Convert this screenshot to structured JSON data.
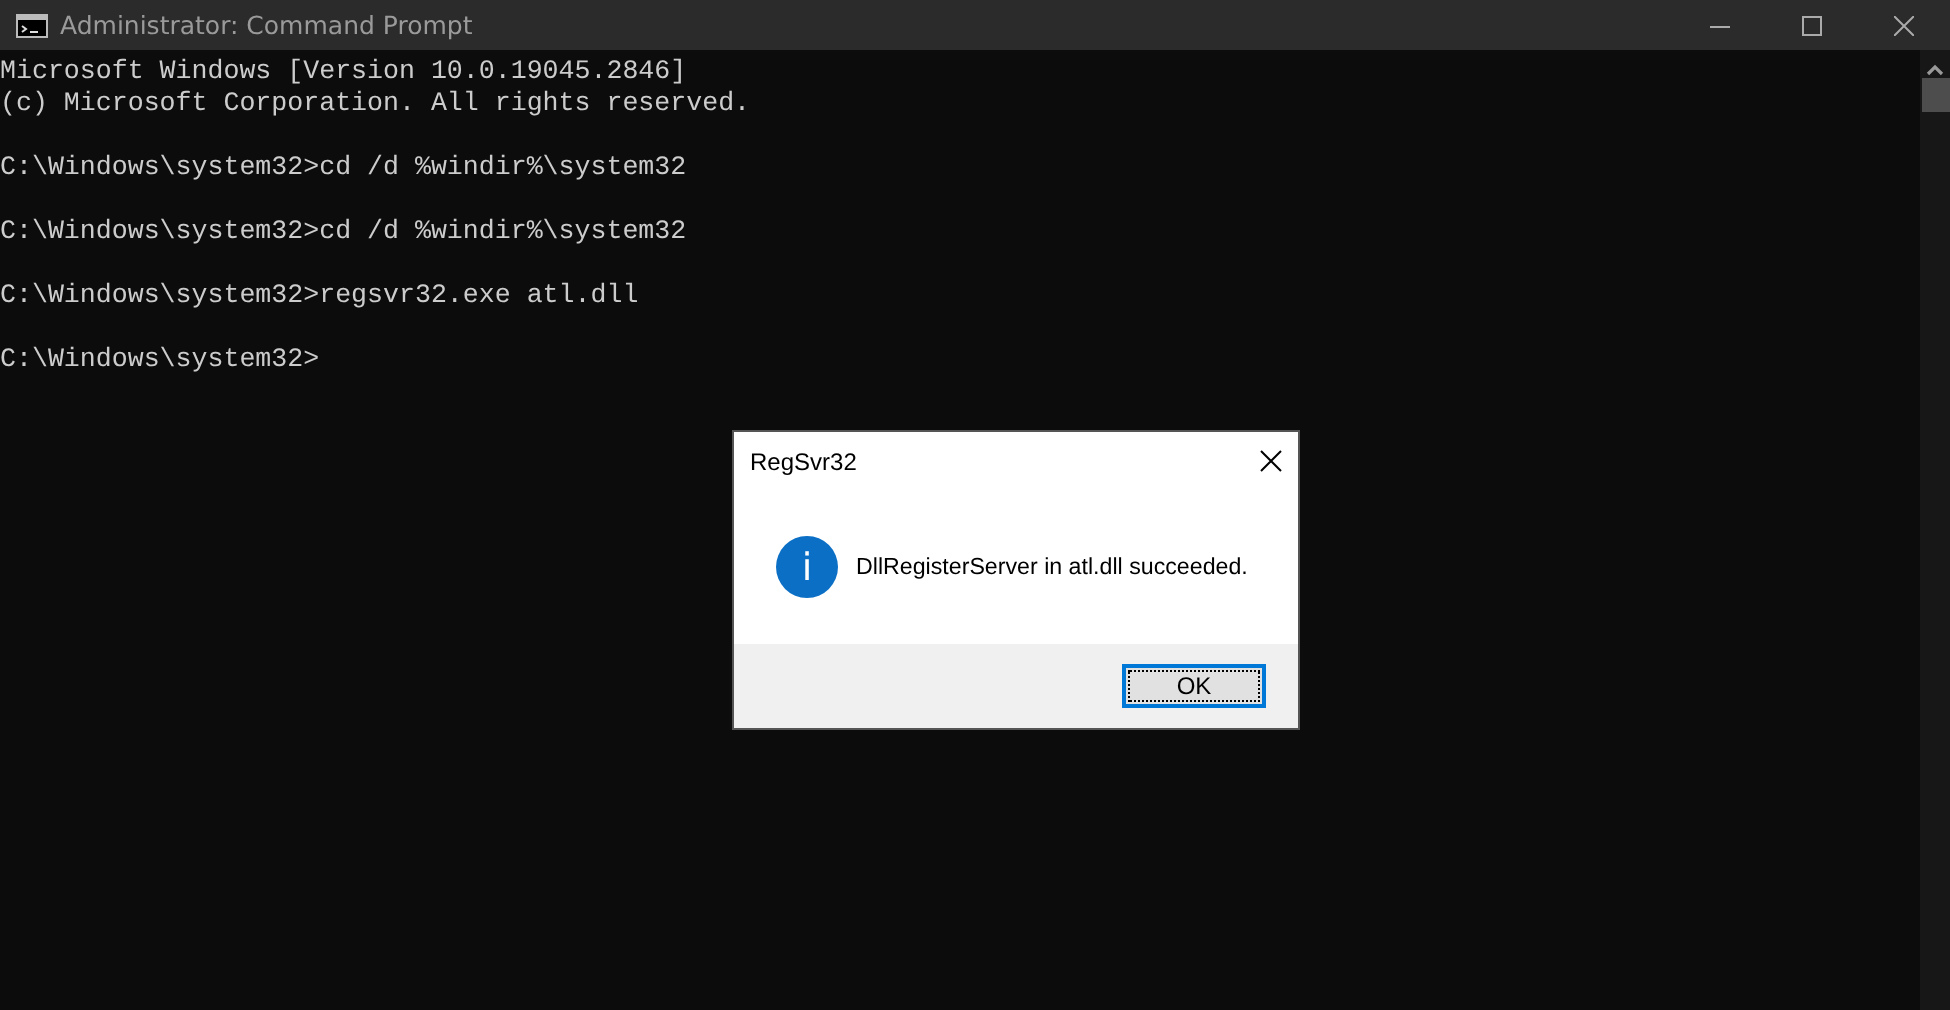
{
  "window": {
    "title": "Administrator: Command Prompt"
  },
  "console": {
    "lines": [
      {
        "text": "Microsoft Windows [Version 10.0.19045.2846]",
        "blank_after": false
      },
      {
        "text": "(c) Microsoft Corporation. All rights reserved.",
        "blank_after": true
      },
      {
        "text": "C:\\Windows\\system32>cd /d %windir%\\system32",
        "blank_after": true
      },
      {
        "text": "C:\\Windows\\system32>cd /d %windir%\\system32",
        "blank_after": true
      },
      {
        "text": "C:\\Windows\\system32>regsvr32.exe atl.dll",
        "blank_after": true
      },
      {
        "text": "C:\\Windows\\system32>",
        "blank_after": false
      }
    ]
  },
  "dialog": {
    "title": "RegSvr32",
    "message": "DllRegisterServer in atl.dll succeeded.",
    "icon_text": "i",
    "buttons": [
      {
        "label": "OK",
        "focused": true
      }
    ]
  }
}
